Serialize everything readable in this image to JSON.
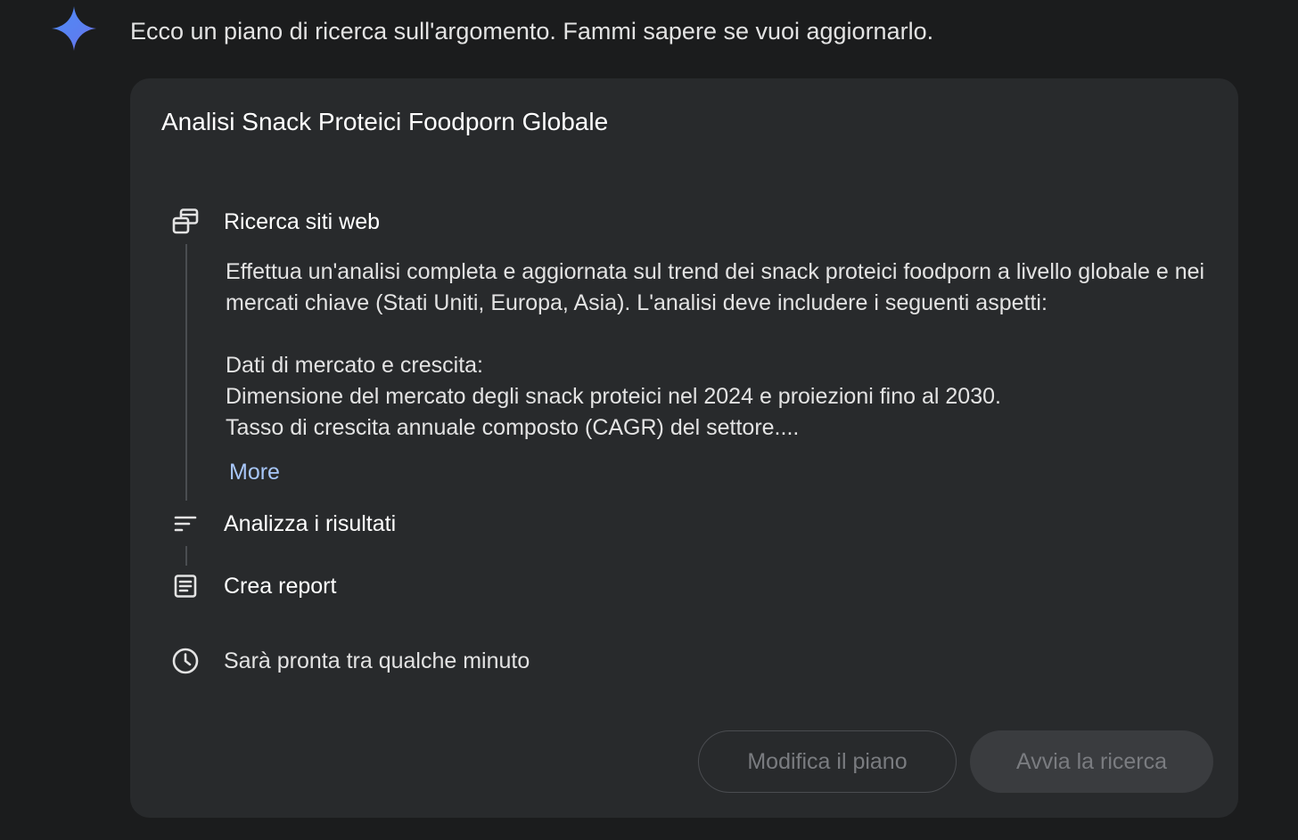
{
  "assistant": {
    "intro_text": "Ecco un piano di ricerca sull'argomento. Fammi sapere se vuoi aggiornarlo.",
    "logo_icon": "gemini-spark-icon"
  },
  "plan": {
    "title": "Analisi Snack Proteici Foodporn Globale",
    "steps": [
      {
        "label": "Ricerca siti web",
        "icon": "web-pages-icon",
        "description": [
          "Effettua un'analisi completa e aggiornata sul trend dei snack proteici foodporn a livello globale e nei mercati chiave (Stati Uniti, Europa, Asia). L'analisi deve includere i seguenti aspetti:",
          "",
          "Dati di mercato e crescita:",
          "Dimensione del mercato degli snack proteici nel 2024 e proiezioni fino al 2030.",
          "Tasso di crescita annuale composto (CAGR) del settore...."
        ],
        "more_label": "More"
      },
      {
        "label": "Analizza i risultati",
        "icon": "sort-lines-icon"
      },
      {
        "label": "Crea report",
        "icon": "document-icon"
      }
    ],
    "eta_text": "Sarà pronta tra qualche minuto",
    "eta_icon": "clock-icon"
  },
  "actions": {
    "edit_label": "Modifica il piano",
    "start_label": "Avvia la ricerca"
  },
  "colors": {
    "background": "#1b1c1d",
    "card": "#282a2c",
    "link": "#a8c7fa",
    "disabled_text": "#7a7c80"
  }
}
